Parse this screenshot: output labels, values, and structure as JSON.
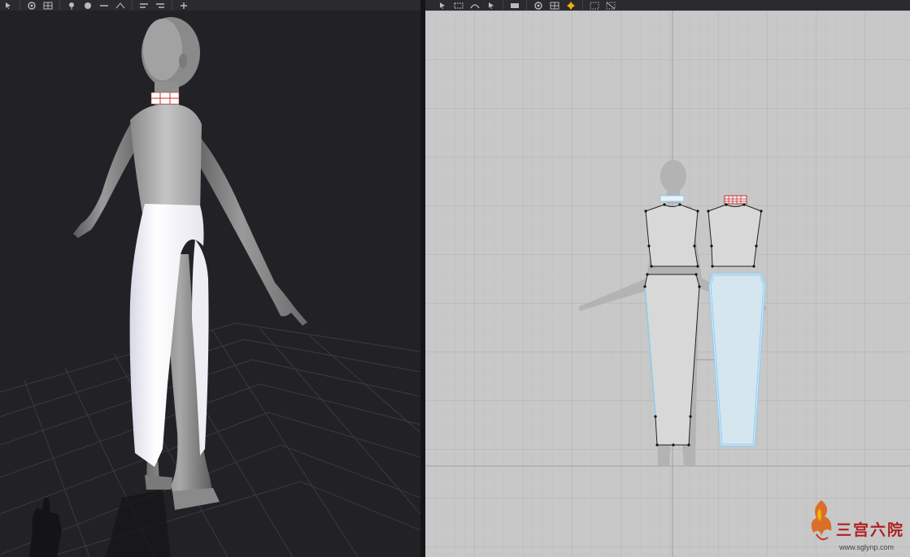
{
  "toolbar_3d": {
    "tools": [
      "select-icon",
      "texture-icon",
      "pattern-icon",
      "pin-icon",
      "face-icon",
      "line-icon",
      "measure-icon",
      "align-left-icon",
      "align-right-icon",
      "transform-icon"
    ]
  },
  "toolbar_2d": {
    "tools": [
      "edit-pattern-icon",
      "edit-point-icon",
      "edit-curve-icon",
      "edit-segment-icon",
      "fill-icon",
      "texture-icon",
      "pattern-icon",
      "pin-icon",
      "grid-icon",
      "snap-icon"
    ]
  },
  "colors": {
    "viewport3d_bg": "#222226",
    "viewport2d_bg": "#c8c8c8",
    "selection_outline": "#8ecbf0",
    "seam_red": "#c83232",
    "accent_yellow": "#f0b400"
  },
  "watermark": {
    "text": "三宫六院",
    "url": "www.sglynp.com"
  }
}
